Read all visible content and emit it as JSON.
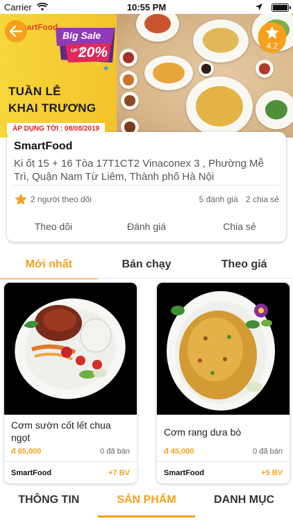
{
  "status_bar": {
    "carrier": "Carrier",
    "time": "10:55 PM"
  },
  "banner": {
    "logo": "SmartFood",
    "sale_label": "Big Sale",
    "sale_upto": "UP TO",
    "sale_percent": "20%",
    "promo_line1": "TUẦN LỄ",
    "promo_line2": "KHAI TRƯƠNG",
    "promo_date": "ÁP DỤNG TỚI : 08/08/2019",
    "rating": "4.2"
  },
  "shop": {
    "name": "SmartFood",
    "address": "Ki ốt 15 + 16 Tòa 17T1CT2 Vinaconex 3 , Phường Mễ Trì, Quận Nam Từ Liêm, Thành phố Hà Nội",
    "followers": "2 người theo dõi",
    "reviews": "5 đánh giá",
    "shares": "2 chia sẻ",
    "actions": {
      "follow": "Theo dõi",
      "rate": "Đánh giá",
      "share": "Chia sẻ"
    }
  },
  "sort_tabs": [
    {
      "label": "Mới nhất",
      "active": true
    },
    {
      "label": "Bán chạy",
      "active": false
    },
    {
      "label": "Theo giá",
      "active": false
    }
  ],
  "products": [
    {
      "name": "Cơm sườn cốt lết chua ngọt",
      "price": "đ 65,000",
      "sold": "0 đã bán",
      "seller": "SmartFood",
      "bv": "+7 BV"
    },
    {
      "name": "Cơm rang dưa bò",
      "price": "đ 45,000",
      "sold": "0 đã bán",
      "seller": "SmartFood",
      "bv": "+5 BV"
    }
  ],
  "bottom_tabs": [
    {
      "label": "THÔNG TIN",
      "active": false
    },
    {
      "label": "SẢN PHẨM",
      "active": true
    },
    {
      "label": "DANH MỤC",
      "active": false
    }
  ],
  "colors": {
    "accent": "#f6a01d",
    "promo_red": "#d7232a"
  }
}
